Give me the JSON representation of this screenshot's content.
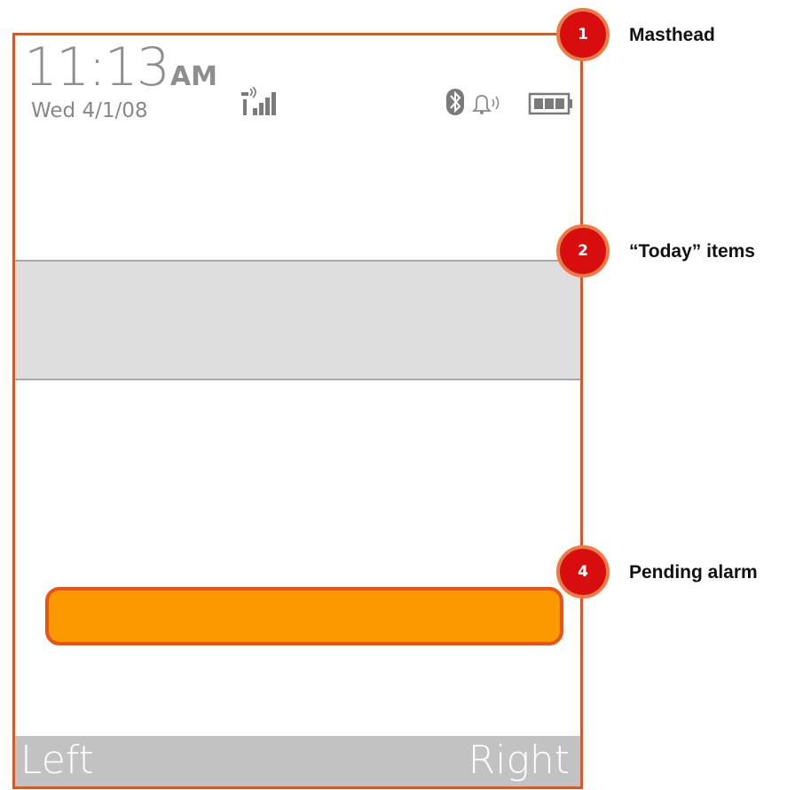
{
  "masthead": {
    "time": "11:13",
    "ampm": "AM",
    "date": "Wed 4/1/08"
  },
  "icons": {
    "signal": "signal-strength-icon",
    "bluetooth": "bluetooth-icon",
    "ringer": "ringer-bell-icon",
    "battery": "battery-icon"
  },
  "softkeys": {
    "left": "Left",
    "right": "Right"
  },
  "callouts": [
    {
      "number": "1",
      "label": "Masthead"
    },
    {
      "number": "2",
      "label": "“Today” items"
    },
    {
      "number": "4",
      "label": "Pending alarm"
    }
  ],
  "colors": {
    "frame": "#e8531a",
    "callout_fill": "#d80d0d",
    "alarm_fill": "#fa9a00",
    "today_band": "#dedede",
    "softkey_bar": "#c2c2c2"
  }
}
